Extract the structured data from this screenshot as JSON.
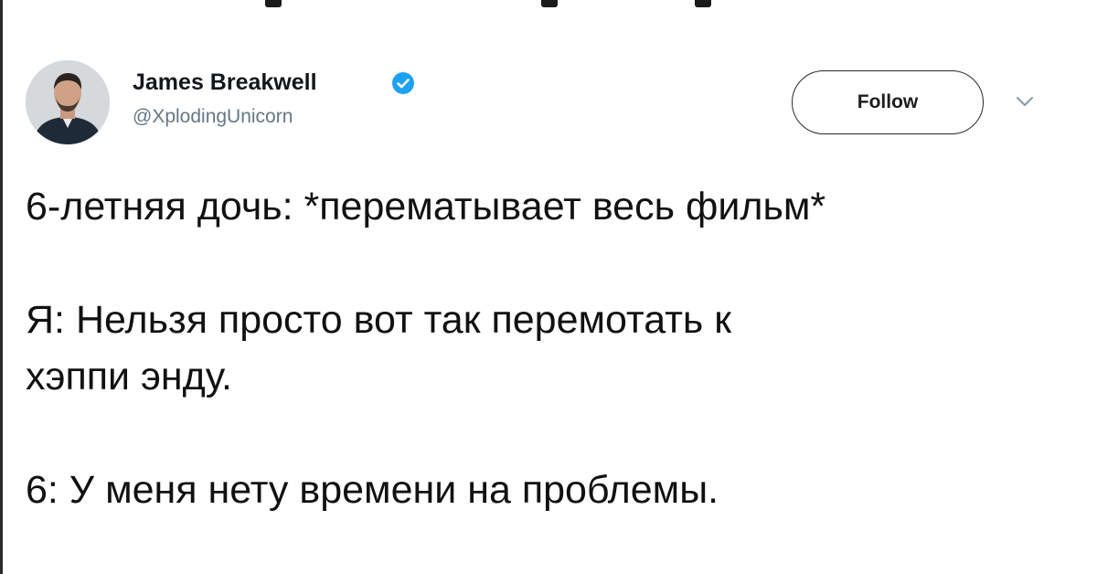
{
  "tweet": {
    "author": {
      "name": "James Breakwell",
      "handle": "@XplodingUnicorn",
      "verified": true,
      "avatar": "avatar-photo"
    },
    "follow_label": "Follow",
    "menu_icon": "chevron-down-icon",
    "lines": [
      "6-летняя дочь: *перематывает весь фильм*",
      "Я: Нельзя просто вот так перемотать к",
      "хэппи энду.",
      "6: У меня нету времени на проблемы."
    ]
  },
  "colors": {
    "verified_badge": "#1da1f2",
    "handle": "#657786",
    "text": "#111111"
  }
}
